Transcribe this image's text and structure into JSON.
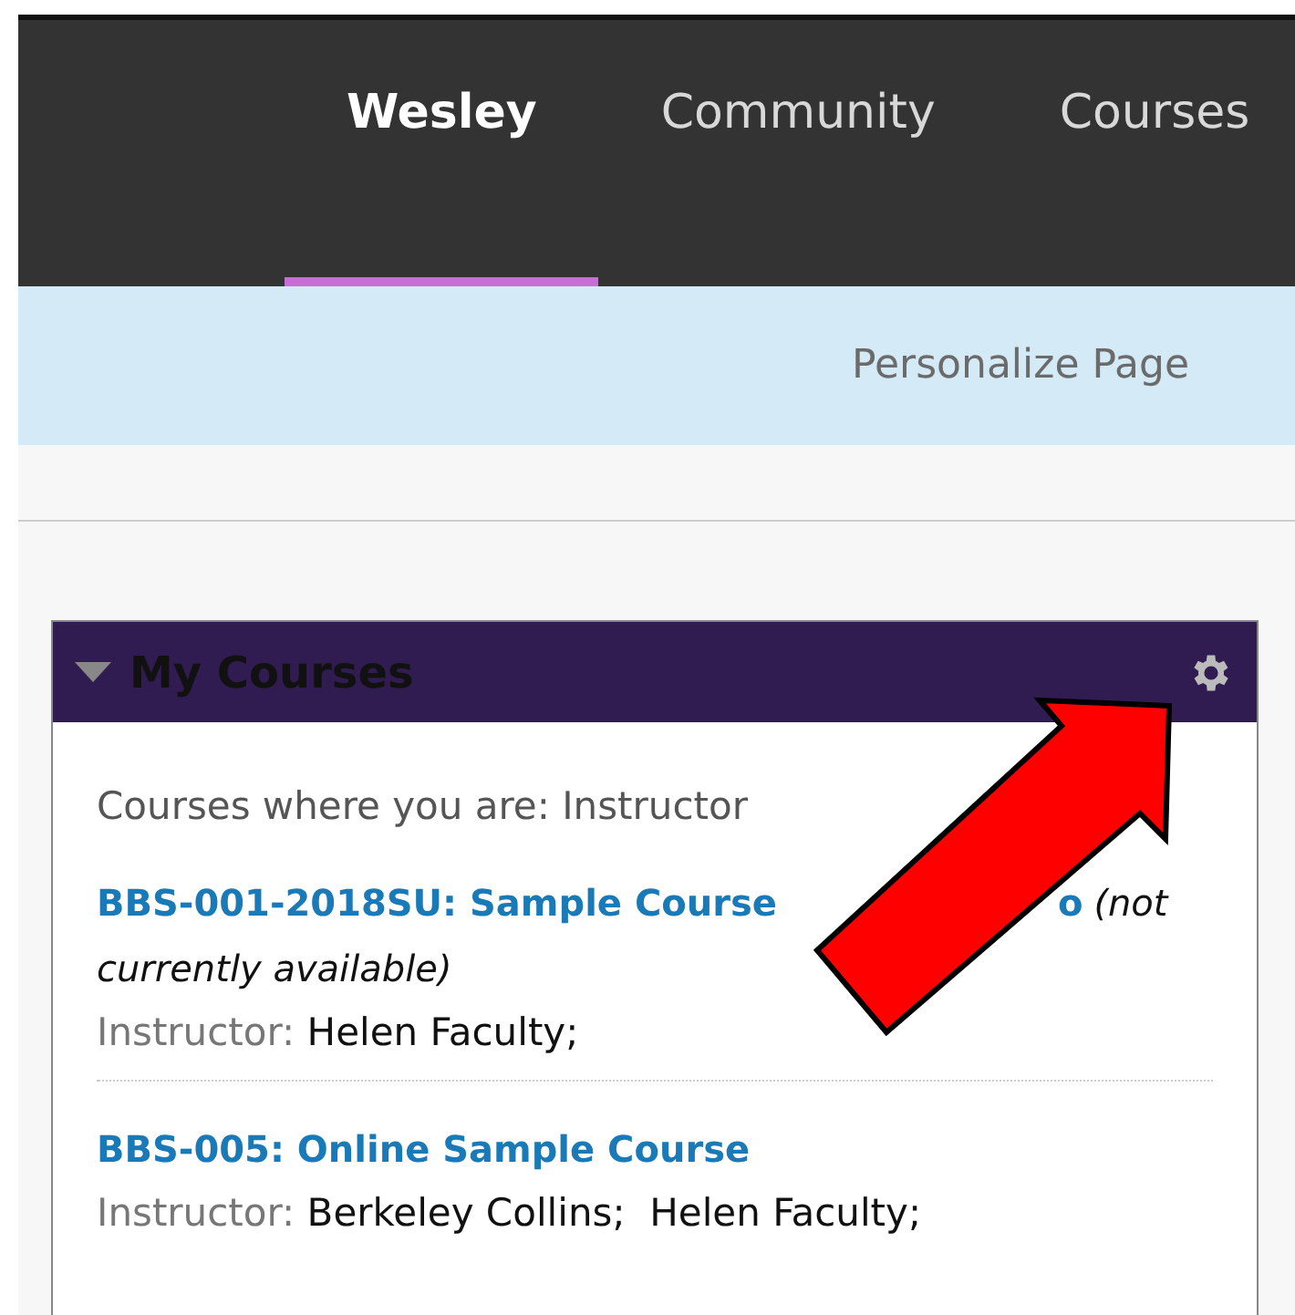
{
  "nav": {
    "tabs": [
      {
        "label": "Wesley",
        "selected": true
      },
      {
        "label": "Community",
        "selected": false
      },
      {
        "label": "Courses",
        "selected": false
      }
    ]
  },
  "subnav": {
    "link": "Personalize Page"
  },
  "module": {
    "title": "My Courses",
    "expanded": true,
    "heading": "Courses where you are: Instructor",
    "courses": [
      {
        "title_start": "BBS-001-2018SU: Sample Course",
        "title_end": "o",
        "note": [
          "(not",
          "currently available)"
        ],
        "instructor_label": "Instructor:",
        "instructors": [
          "Helen Faculty;"
        ]
      },
      {
        "title_start": "BBS-005: Online Sample Course",
        "instructor_label": "Instructor:",
        "instructors": [
          "Berkeley Collins;",
          "Helen Faculty;"
        ]
      }
    ]
  }
}
